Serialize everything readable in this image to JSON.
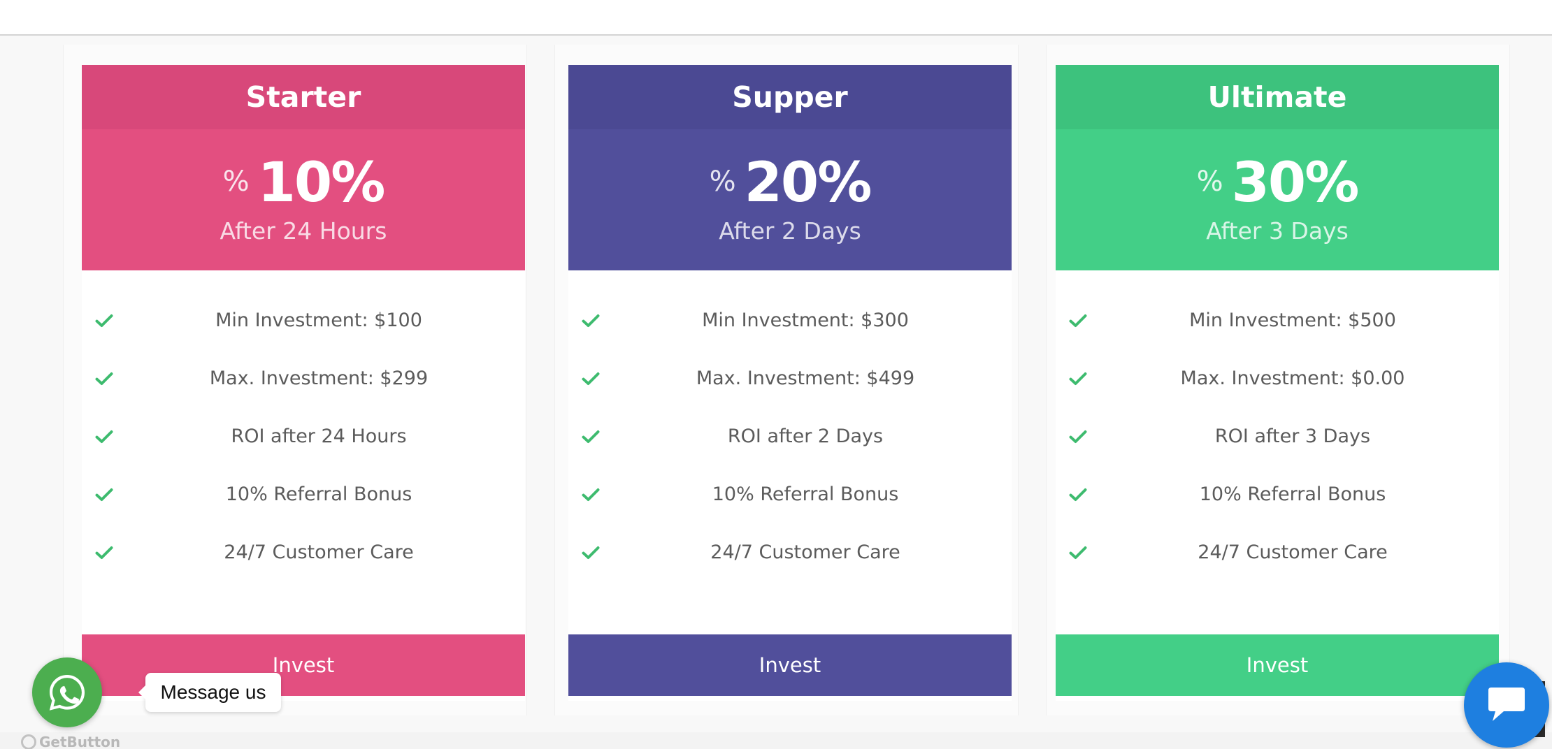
{
  "plans": [
    {
      "name": "Starter",
      "percent_symbol": "%",
      "rate": "10%",
      "period": "After 24 Hours",
      "features": [
        "Min Investment: $100",
        "Max. Investment: $299",
        "ROI after 24 Hours",
        "10% Referral Bonus",
        "24/7 Customer Care"
      ],
      "button_label": "Invest",
      "color_head": "#d8487a",
      "color_body": "#e34f80"
    },
    {
      "name": "Supper",
      "percent_symbol": "%",
      "rate": "20%",
      "period": "After 2 Days",
      "features": [
        "Min Investment: $300",
        "Max. Investment: $499",
        "ROI after 2 Days",
        "10% Referral Bonus",
        "24/7 Customer Care"
      ],
      "button_label": "Invest",
      "color_head": "#4b4993",
      "color_body": "#514f9b"
    },
    {
      "name": "Ultimate",
      "percent_symbol": "%",
      "rate": "30%",
      "period": "After 3 Days",
      "features": [
        "Min Investment: $500",
        "Max. Investment: $0.00",
        "ROI after 3 Days",
        "10% Referral Bonus",
        "24/7 Customer Care"
      ],
      "button_label": "Invest",
      "color_head": "#3dc27d",
      "color_body": "#43cf87"
    }
  ],
  "colors": {
    "check": "#3dbb6e",
    "feature_text": "#5b5b5b"
  },
  "widgets": {
    "whatsapp_label": "Message us",
    "getbutton_label": "GetButton",
    "whatsapp_icon": "whatsapp-icon",
    "chat_icon": "chat-bubble-icon"
  }
}
